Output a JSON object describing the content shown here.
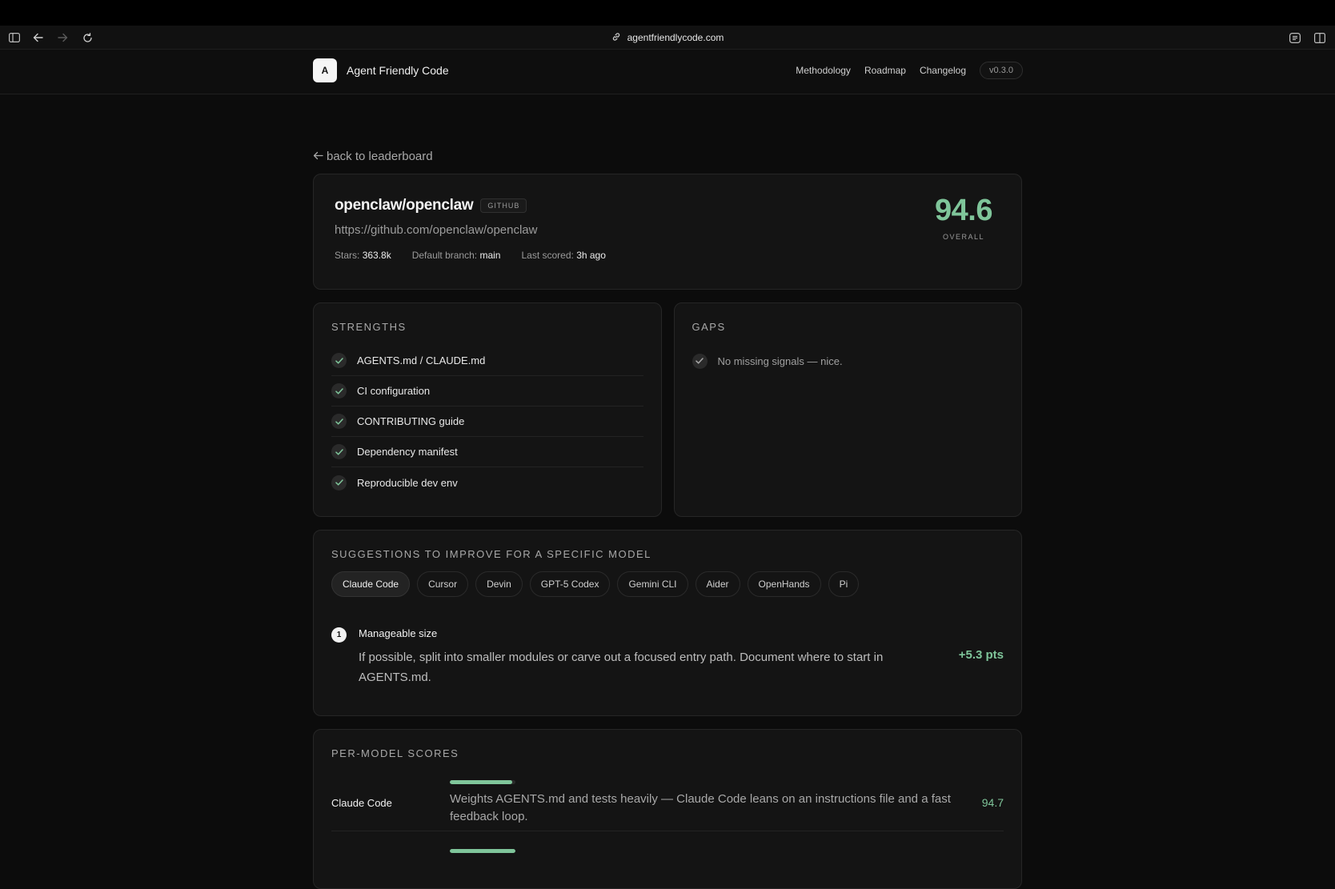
{
  "browser": {
    "url": "agentfriendlycode.com",
    "icons": [
      "sidebar-icon",
      "back-arrow-icon",
      "forward-arrow-icon",
      "reload-icon",
      "link-icon",
      "reader-icon",
      "split-view-icon"
    ]
  },
  "header": {
    "logo_letter": "A",
    "brand": "Agent Friendly Code",
    "nav": [
      "Methodology",
      "Roadmap",
      "Changelog"
    ],
    "version": "v0.3.0"
  },
  "back_link": "back to leaderboard",
  "repo": {
    "name": "openclaw/openclaw",
    "badge": "GITHUB",
    "url": "https://github.com/openclaw/openclaw",
    "stars_label": "Stars:",
    "stars": "363.8k",
    "branch_label": "Default branch:",
    "branch": "main",
    "scored_label": "Last scored:",
    "scored": "3h ago",
    "score": "94.6",
    "score_label": "OVERALL"
  },
  "strengths": {
    "title": "STRENGTHS",
    "items": [
      "AGENTS.md / CLAUDE.md",
      "CI configuration",
      "CONTRIBUTING guide",
      "Dependency manifest",
      "Reproducible dev env"
    ]
  },
  "gaps": {
    "title": "GAPS",
    "items": [
      "No missing signals — nice."
    ]
  },
  "suggestions": {
    "title": "SUGGESTIONS TO IMPROVE FOR A SPECIFIC MODEL",
    "models": [
      "Claude Code",
      "Cursor",
      "Devin",
      "GPT-5 Codex",
      "Gemini CLI",
      "Aider",
      "OpenHands",
      "Pi"
    ],
    "active": "Claude Code",
    "items": [
      {
        "number": "1",
        "title": "Manageable size",
        "description": "If possible, split into smaller modules or carve out a focused entry path. Document where to start in AGENTS.md.",
        "points": "+5.3 pts"
      }
    ]
  },
  "per_model": {
    "title": "PER-MODEL SCORES",
    "rows": [
      {
        "name": "Claude Code",
        "description": "Weights AGENTS.md and tests heavily — Claude Code leans on an instructions file and a fast feedback loop.",
        "score": "94.7",
        "fraction": 0.947
      }
    ]
  },
  "colors": {
    "accent": "#7fc59a",
    "background": "#0c0c0c",
    "card": "#141414"
  }
}
